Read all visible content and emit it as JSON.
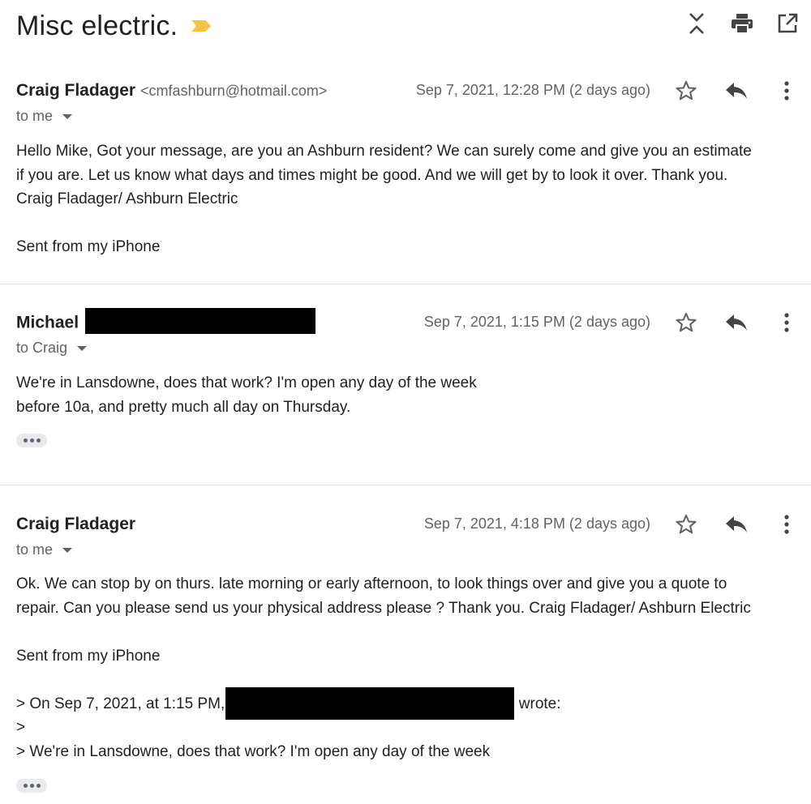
{
  "thread": {
    "subject": "Misc electric.",
    "importance_icon": "importance-marker-icon",
    "importance_color": "#f5c542",
    "top_actions": [
      "expand-collapse-icon",
      "print-icon",
      "open-new-window-icon"
    ]
  },
  "messages": [
    {
      "sender": "Craig Fladager",
      "email": "<cmfashburn@hotmail.com>",
      "date": "Sep 7, 2021, 12:28 PM (2 days ago)",
      "to": "to me",
      "body": [
        "Hello Mike, Got your message, are you an Ashburn resident? We can surely come and give you an estimate",
        "if you are. Let us know what days and times might be good. And we will get by to look it over. Thank you.",
        "Craig Fladager/ Ashburn Electric",
        "",
        "Sent from my iPhone"
      ]
    },
    {
      "sender": "Michael",
      "email": "",
      "date": "Sep 7, 2021, 1:15 PM (2 days ago)",
      "to": "to Craig",
      "body": [
        "We're in Lansdowne, does that work? I'm open any day of the week",
        "before 10a, and pretty much all day on Thursday."
      ]
    },
    {
      "sender": "Craig Fladager",
      "email": "",
      "date": "Sep 7, 2021, 4:18 PM (2 days ago)",
      "to": "to me",
      "body": [
        "Ok. We can stop by on thurs. late morning or early afternoon, to look things over and give you a quote to",
        "repair. Can you please send us your physical address please ? Thank you. Craig Fladager/ Ashburn Electric",
        "",
        "Sent from my iPhone",
        ""
      ],
      "quote": {
        "line1_prefix": "> On Sep 7, 2021, at 1:15 PM,",
        "line1_suffix": "wrote:",
        "line2": ">",
        "line3": "> We're in Lansdowne, does that work? I'm open any day of the week"
      }
    }
  ]
}
